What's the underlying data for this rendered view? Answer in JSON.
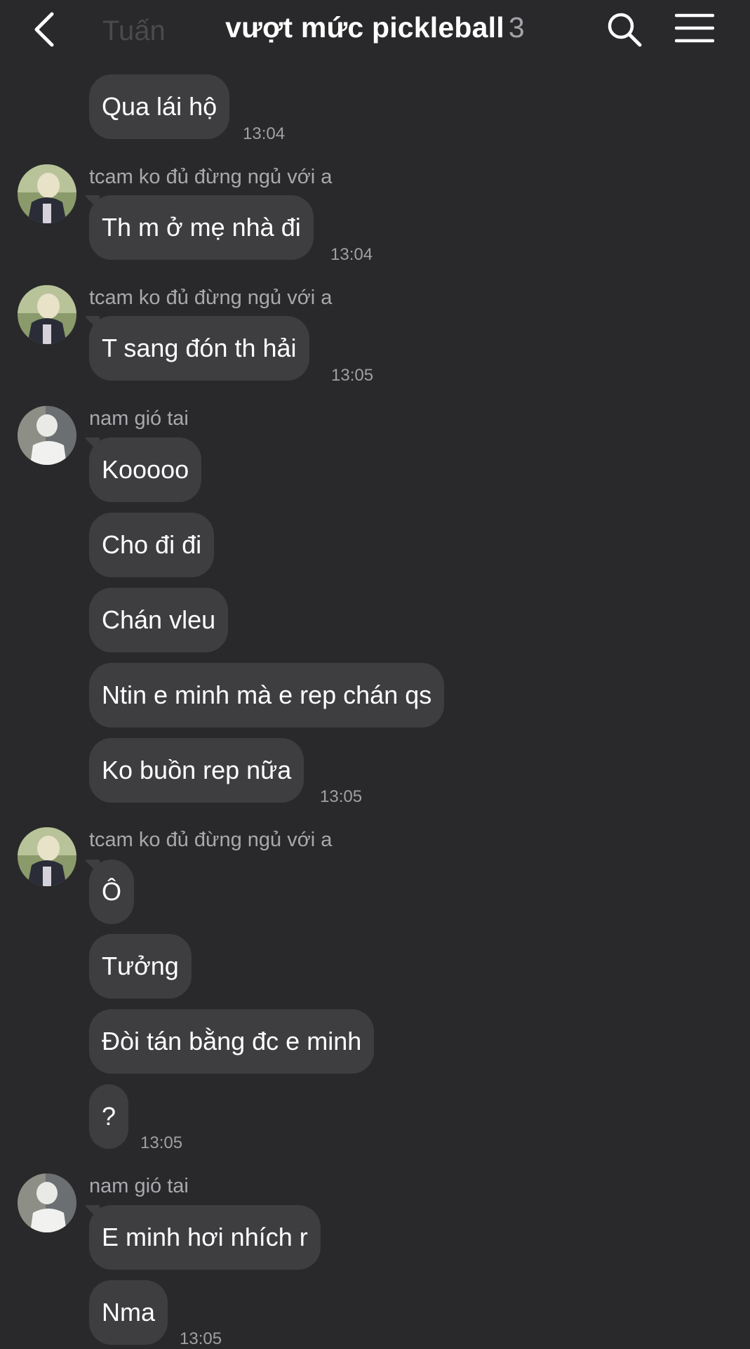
{
  "header": {
    "title": "vượt mức pickleball",
    "member_count": "3",
    "ghost_text": "Tuấn"
  },
  "colors": {
    "background": "#29292b",
    "bubble": "#3e3e41",
    "sender_name": "#a9a9ad",
    "timestamp": "#a0a0a4"
  },
  "messages": {
    "m1": {
      "text": "Qua lái hộ",
      "time": "13:04"
    },
    "g1": {
      "sender": "tcam ko đủ đừng ngủ với a",
      "text": "Th m ở mẹ nhà đi",
      "time": "13:04"
    },
    "g2": {
      "sender": "tcam ko đủ đừng ngủ với a",
      "text": "T sang đón th hải",
      "time": "13:05"
    },
    "g3": {
      "sender": "nam gió tai",
      "texts": [
        "Kooooo",
        "Cho đi đi",
        "Chán vleu",
        "Ntin e minh mà e rep chán qs",
        "Ko buồn rep nữa"
      ],
      "time": "13:05"
    },
    "g4": {
      "sender": "tcam ko đủ đừng ngủ với a",
      "texts": [
        "Ô",
        "Tưởng",
        "Đòi tán bằng đc e minh",
        "?"
      ],
      "time": "13:05"
    },
    "g5": {
      "sender": "nam gió tai",
      "texts": [
        "E minh hơi nhích r",
        "Nma"
      ],
      "time": "13:05"
    }
  },
  "icons": {
    "back": "chevron-left-icon",
    "search": "search-icon",
    "menu": "hamburger-menu-icon"
  }
}
